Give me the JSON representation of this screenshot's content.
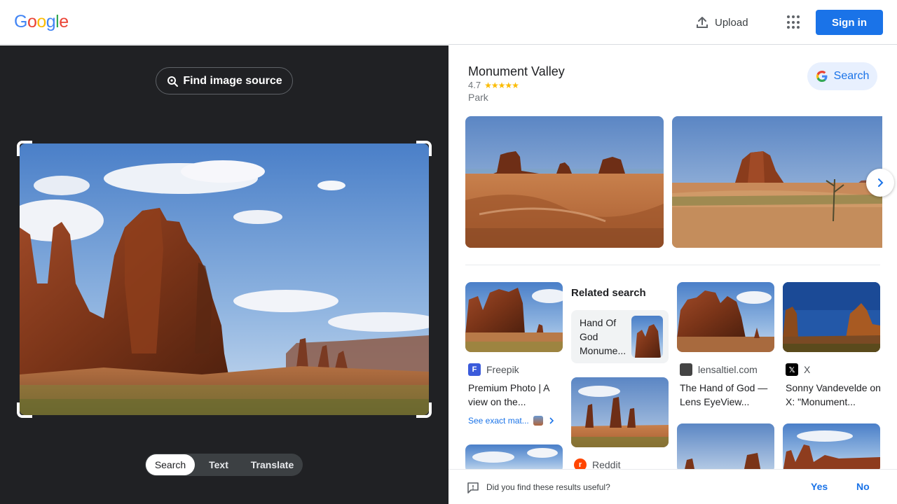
{
  "header": {
    "logo_letters": [
      {
        "ch": "G",
        "color": "#4285f4"
      },
      {
        "ch": "o",
        "color": "#ea4335"
      },
      {
        "ch": "o",
        "color": "#fbbc05"
      },
      {
        "ch": "g",
        "color": "#4285f4"
      },
      {
        "ch": "l",
        "color": "#34a853"
      },
      {
        "ch": "e",
        "color": "#ea4335"
      }
    ],
    "upload_label": "Upload",
    "signin_label": "Sign in"
  },
  "lens": {
    "find_source_label": "Find image source",
    "tabs": [
      "Search",
      "Text",
      "Translate"
    ],
    "active_tab": "Search"
  },
  "knowledge": {
    "title": "Monument Valley",
    "rating": "4.7",
    "stars": "★★★★★",
    "type": "Park",
    "search_label": "Search"
  },
  "results": {
    "related_heading": "Related search",
    "related_query": "Hand Of God Monume...",
    "items": [
      {
        "source": "Freepik",
        "title": "Premium Photo | A view on the...",
        "favicon": "F",
        "favicon_color": "#3b5bdb"
      },
      {
        "source": "lensaltiel.com",
        "title": "The Hand of God — Lens EyeView...",
        "favicon": "",
        "favicon_color": "#444444"
      },
      {
        "source": "X",
        "title": "Sonny Vandevelde on X: \"Monument...",
        "favicon": "𝕏",
        "favicon_color": "#000000"
      },
      {
        "source": "Reddit",
        "title": "",
        "favicon": "r",
        "favicon_color": "#ff4500"
      }
    ],
    "see_exact_label": "See exact mat..."
  },
  "feedback": {
    "question": "Did you find these results useful?",
    "yes": "Yes",
    "no": "No"
  },
  "colors": {
    "accent": "#1a73e8",
    "dark_panel": "#202124"
  }
}
